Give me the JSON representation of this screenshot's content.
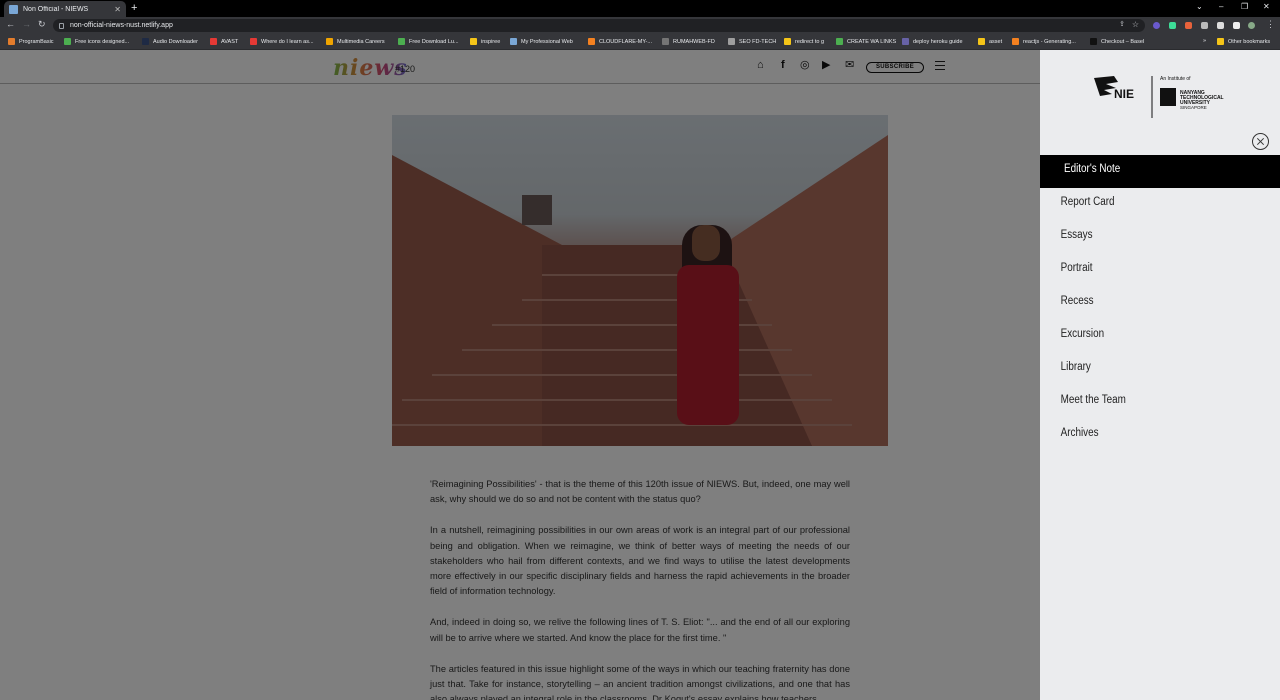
{
  "browser": {
    "tab_title": "Non Official - NIEWS",
    "url": "non-official-niews-nust.netlify.app",
    "bookmarks": [
      {
        "label": "ProgramBasic",
        "color": "#e37c2c"
      },
      {
        "label": "Free icons designed...",
        "color": "#4caf50"
      },
      {
        "label": "Audio Downloader",
        "color": "#1e2a44"
      },
      {
        "label": "AVAST",
        "color": "#e53935"
      },
      {
        "label": "Where do I learn as...",
        "color": "#e53935"
      },
      {
        "label": "Multimedia Careers",
        "color": "#f0a500"
      },
      {
        "label": "Free Download Lu...",
        "color": "#4caf50"
      },
      {
        "label": "inspiree",
        "color": "#f5c518"
      },
      {
        "label": "My Professional Web",
        "color": "#7aa7d6"
      },
      {
        "label": "CLOUDFLARE-MY-...",
        "color": "#f48120"
      },
      {
        "label": "RUMAHWEB-FD",
        "color": "#757575"
      },
      {
        "label": "SEO FD-TECH",
        "color": "#9e9e9e"
      },
      {
        "label": "redirect to g",
        "color": "#f5c518"
      },
      {
        "label": "CREATE WA LINKS",
        "color": "#4caf50"
      },
      {
        "label": "deploy heroku guide",
        "color": "#6762a6"
      },
      {
        "label": "asset",
        "color": "#f5c518"
      },
      {
        "label": "reactjs - Generating...",
        "color": "#f48120"
      },
      {
        "label": "Checkout – Basel",
        "color": "#111111"
      }
    ],
    "other_bookmarks": "Other bookmarks"
  },
  "header": {
    "logo": "niews",
    "issue": "#120",
    "subscribe": "SUBSCRIBE"
  },
  "article": {
    "paragraphs": [
      "'Reimagining Possibilities' - that is the theme of this 120th issue of NIEWS. But, indeed, one may well ask, why should we do so and not be content with the status quo?",
      "In a nutshell, reimagining possibilities in our own areas of work is an integral part of our professional being and obligation. When we reimagine, we think of better ways of meeting the needs of our stakeholders who hail from different contexts, and we find ways to utilise the latest developments more effectively in our specific disciplinary fields and harness the rapid achievements in the broader field of information technology.",
      "And, indeed in doing so, we relive the following lines of T. S. Eliot: \"... and the end of all our exploring will be to arrive where we started. And know the place for the first time. \"",
      "The articles featured in this issue highlight some of the ways in which our teaching fraternity has done just that. Take for instance, storytelling – an ancient tradition amongst civilizations, and one that has also always played an integral role in the classrooms. Dr Kogut's essay explains how teachers"
    ]
  },
  "sidemenu": {
    "institute": "An Institute of",
    "nie": "NIE",
    "ntu": [
      "NANYANG",
      "TECHNOLOGICAL",
      "UNIVERSITY",
      "SINGAPORE"
    ],
    "items": [
      {
        "label": "Editor's Note"
      },
      {
        "label": "Report Card"
      },
      {
        "label": "Essays"
      },
      {
        "label": "Portrait"
      },
      {
        "label": "Recess"
      },
      {
        "label": "Excursion"
      },
      {
        "label": "Library"
      },
      {
        "label": "Meet the Team"
      },
      {
        "label": "Archives"
      }
    ]
  }
}
